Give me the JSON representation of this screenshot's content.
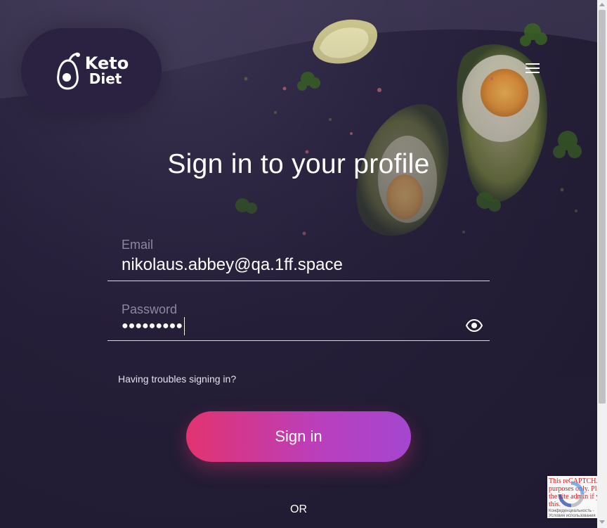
{
  "logo": {
    "line1": "Keto",
    "line2": "Diet"
  },
  "header": {
    "menu_icon": "hamburger-menu-icon"
  },
  "page_title": "Sign in to your profile",
  "form": {
    "email": {
      "label": "Email",
      "value": "nikolaus.abbey@qa.1ff.space"
    },
    "password": {
      "label": "Password",
      "masked_value": "●●●●●●●●●",
      "toggle_icon": "eye-icon"
    },
    "trouble_link": "Having troubles signing in?",
    "submit_label": "Sign in",
    "divider_text": "OR"
  },
  "recaptcha": {
    "error_text": "This reCAPTCHA is for testing purposes only. Please report to the site admin if you are seeing this.",
    "footer_text": "Конфиденциальность - Условия использования"
  },
  "colors": {
    "background": "#211b33",
    "logo_pill": "#2a2240",
    "button_start": "#e2336f",
    "button_end": "#a446d0",
    "label": "#8e879f"
  }
}
